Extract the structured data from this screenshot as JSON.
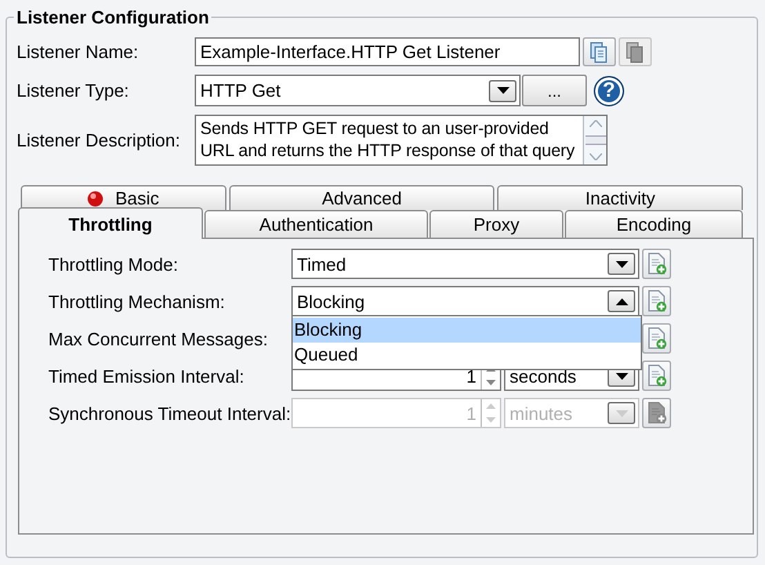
{
  "group": {
    "title": "Listener Configuration"
  },
  "fields": [
    {
      "label": "Listener Name:",
      "kind": "text",
      "value": "Example-Interface.HTTP Get Listener"
    },
    {
      "label": "Listener Type:",
      "kind": "select",
      "value": "HTTP Get",
      "button": "...",
      "help": "?"
    },
    {
      "label": "Listener Description:",
      "kind": "textarea",
      "value": "Sends HTTP GET request to an user-provided URL and returns the HTTP response of that query"
    }
  ],
  "tab_rows": [
    [
      {
        "label": "Basic",
        "selected": false,
        "error": true
      },
      {
        "label": "Advanced",
        "selected": false,
        "error": false
      },
      {
        "label": "Inactivity",
        "selected": false,
        "error": false
      }
    ],
    [
      {
        "label": "Throttling",
        "selected": true,
        "error": false
      },
      {
        "label": "Authentication",
        "selected": false,
        "error": false
      },
      {
        "label": "Proxy",
        "selected": false,
        "error": false
      },
      {
        "label": "Encoding",
        "selected": false,
        "error": false
      }
    ]
  ],
  "settings": [
    {
      "label": "Throttling Mode:",
      "kind": "select",
      "value": "Timed",
      "expanded": false,
      "disabled": false
    },
    {
      "label": "Throttling Mechanism:",
      "kind": "select",
      "value": "Blocking",
      "expanded": true,
      "disabled": false,
      "options": [
        {
          "label": "Blocking",
          "selected": true
        },
        {
          "label": "Queued",
          "selected": false
        }
      ]
    },
    {
      "label": "Max Concurrent Messages:",
      "kind": "covered",
      "disabled": false
    },
    {
      "label": "Timed Emission Interval:",
      "kind": "interval",
      "value": "1",
      "unit": "seconds",
      "disabled": false
    },
    {
      "label": "Synchronous Timeout Interval:",
      "kind": "interval",
      "value": "1",
      "unit": "minutes",
      "disabled": true
    }
  ]
}
